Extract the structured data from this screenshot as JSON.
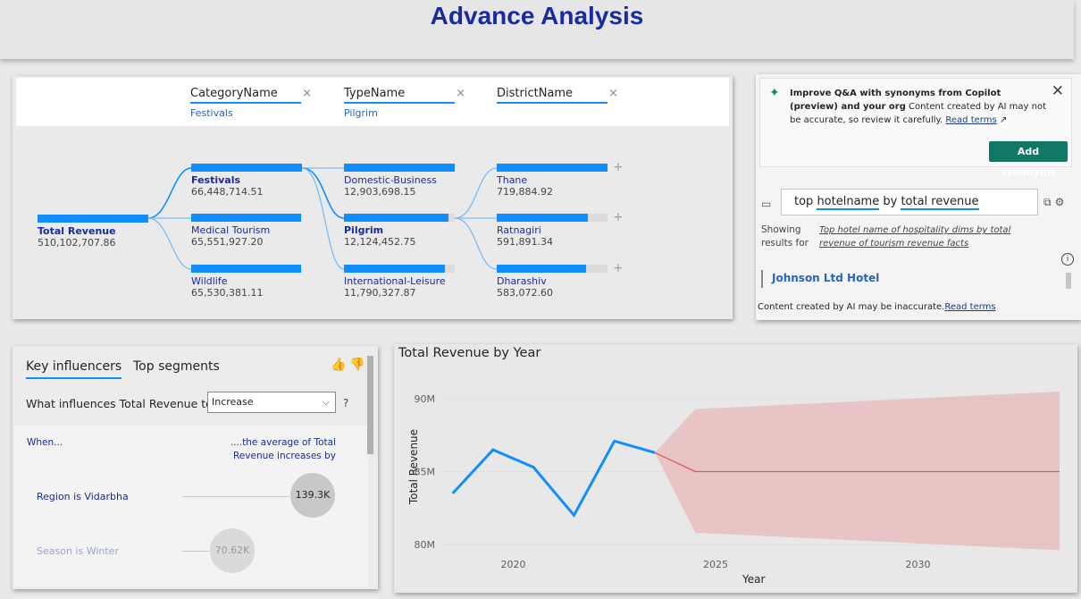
{
  "page": {
    "title": "Advance Analysis"
  },
  "decomposition_tree": {
    "levels": [
      {
        "name": "CategoryName",
        "selected": "Festivals"
      },
      {
        "name": "TypeName",
        "selected": "Pilgrim"
      },
      {
        "name": "DistrictName",
        "selected": ""
      }
    ],
    "close_glyph": "×",
    "expand_glyph": "+",
    "root": {
      "label": "Total Revenue",
      "value": "510,102,707.86",
      "fill": 1.0
    },
    "category_nodes": [
      {
        "label": "Festivals",
        "value": "66,448,714.51",
        "fill": 1.0,
        "selected": true
      },
      {
        "label": "Medical Tourism",
        "value": "65,551,927.20",
        "fill": 0.99,
        "selected": false
      },
      {
        "label": "Wildlife",
        "value": "65,530,381.11",
        "fill": 0.99,
        "selected": false
      }
    ],
    "type_nodes": [
      {
        "label": "Domestic-Business",
        "value": "12,903,698.15",
        "fill": 1.0,
        "selected": false
      },
      {
        "label": "Pilgrim",
        "value": "12,124,452.75",
        "fill": 0.94,
        "selected": true
      },
      {
        "label": "International-Leisure",
        "value": "11,790,327.87",
        "fill": 0.91,
        "selected": false
      }
    ],
    "district_nodes": [
      {
        "label": "Thane",
        "value": "719,884.92",
        "fill": 1.0
      },
      {
        "label": "Ratnagiri",
        "value": "591,891.34",
        "fill": 0.82
      },
      {
        "label": "Dharashiv",
        "value": "583,072.60",
        "fill": 0.81
      }
    ]
  },
  "copilot": {
    "sparkle_icon": "sparkle-icon",
    "sparkle_glyph": "✦",
    "title_bold": "Improve Q&A with synonyms from Copilot (preview) and your org",
    "body": " Content created by AI may not be accurate, so review it carefully. ",
    "read_terms": "Read terms",
    "external_glyph": "↗",
    "close_glyph": "✕",
    "button_label": "Add synonyms"
  },
  "qa": {
    "chat_glyph": "▭",
    "query_parts": [
      "top ",
      "hotelname",
      " by ",
      "total revenue"
    ],
    "tool_glyphs": "⧉⚙",
    "showing_label": "Showing results for",
    "showing_query": "Top hotel name of hospitality dims by total revenue of tourism revenue facts",
    "info_glyph": "i",
    "answer": "Johnson Ltd Hotel",
    "disclaimer": "Content created by AI may be inaccurate.",
    "disclaimer_link": "Read terms"
  },
  "key_influencers": {
    "tabs": [
      "Key influencers",
      "Top segments"
    ],
    "thumbs_glyphs": "👍👎",
    "question": "What influences Total Revenue to",
    "select_value": "Increase",
    "select_chevron": "⌵",
    "help_glyph": "?",
    "when_label": "When...",
    "avg_label": "....the average of Total Revenue increases by",
    "rows": [
      {
        "label": "Region is Vidarbha",
        "value": "139.3K",
        "faded": false
      },
      {
        "label": "Season is Winter",
        "value": "70.62K",
        "faded": true
      }
    ]
  },
  "forecast_chart": {
    "chart_data": {
      "type": "line",
      "title": "Total Revenue by Year",
      "xlabel": "Year",
      "ylabel": "Total Revenue",
      "xlim": [
        2018.2,
        2033.5
      ],
      "ylim": [
        79.5,
        91.3
      ],
      "y_ticks": [
        80,
        85,
        90
      ],
      "y_tick_labels": [
        "80M",
        "85M",
        "90M"
      ],
      "x_ticks": [
        2020,
        2025,
        2030
      ],
      "x_tick_labels": [
        "2020",
        "2025",
        "2030"
      ],
      "grid": true,
      "series": [
        {
          "values": [
            {
              "x": 2018.5,
              "y": 83.5
            },
            {
              "x": 2019.5,
              "y": 86.5
            },
            {
              "x": 2020.5,
              "y": 85.3
            },
            {
              "x": 2021.5,
              "y": 82.0
            },
            {
              "x": 2022.5,
              "y": 87.1
            },
            {
              "x": 2023.5,
              "y": 86.3
            }
          ],
          "color": "#118dff"
        },
        {
          "values": [
            {
              "x": 2023.5,
              "y": 86.3
            },
            {
              "x": 2024.5,
              "y": 85.0
            },
            {
              "x": 2033.5,
              "y": 85.0
            }
          ],
          "color": "#e0565b"
        }
      ],
      "confidence_band": {
        "x": [
          2023.5,
          2024.5,
          2033.5
        ],
        "upper": [
          86.3,
          89.3,
          90.5
        ],
        "lower": [
          86.3,
          80.8,
          79.6
        ],
        "color": "#e8a5a8"
      }
    }
  }
}
